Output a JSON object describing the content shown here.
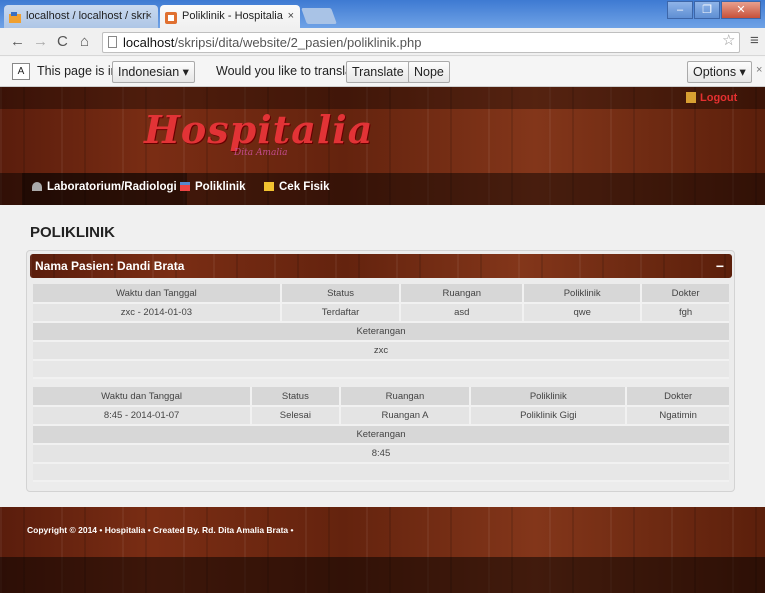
{
  "browser": {
    "tabs": [
      {
        "label": "localhost / localhost / skri",
        "close": "×"
      },
      {
        "label": "Poliklinik - Hospitalia",
        "close": "×"
      }
    ],
    "url_host": "localhost",
    "url_path": "/skripsi/dita/website/2_pasien/poliklinik.php",
    "translate": {
      "text_before": "This page is in",
      "language": "Indonesian ▾",
      "text_after": "Would you like to translate it?",
      "translate_label": "Translate",
      "nope_label": "Nope",
      "options_label": "Options ▾",
      "close": "×"
    }
  },
  "header": {
    "logout_label": "Logout",
    "logo": "Hospitalia",
    "logo_sub": "Dita Amalia"
  },
  "nav": [
    {
      "label": "Laboratorium/Radiologi"
    },
    {
      "label": "Poliklinik"
    },
    {
      "label": "Cek Fisik"
    }
  ],
  "main": {
    "title": "POLIKLINIK",
    "panel_title": "Nama Pasien: Dandi Brata",
    "collapse": "−",
    "headers": [
      "Waktu dan Tanggal",
      "Status",
      "Ruangan",
      "Poliklinik",
      "Dokter"
    ],
    "keterangan_label": "Keterangan",
    "records": [
      {
        "cells": [
          "zxc - 2014-01-03",
          "Terdaftar",
          "asd",
          "qwe",
          "fgh"
        ],
        "keterangan": "zxc"
      },
      {
        "cells": [
          "8:45 - 2014-01-07",
          "Selesai",
          "Ruangan A",
          "Poliklinik Gigi",
          "Ngatimin"
        ],
        "keterangan": "8:45"
      }
    ]
  },
  "footer": {
    "copyright": "Copyright © 2014 • Hospitalia • Created By. Rd. Dita Amalia Brata •"
  },
  "colors": {
    "accent": "#e23336",
    "wood": "#6b2611",
    "panel_header": "#6b2611"
  }
}
